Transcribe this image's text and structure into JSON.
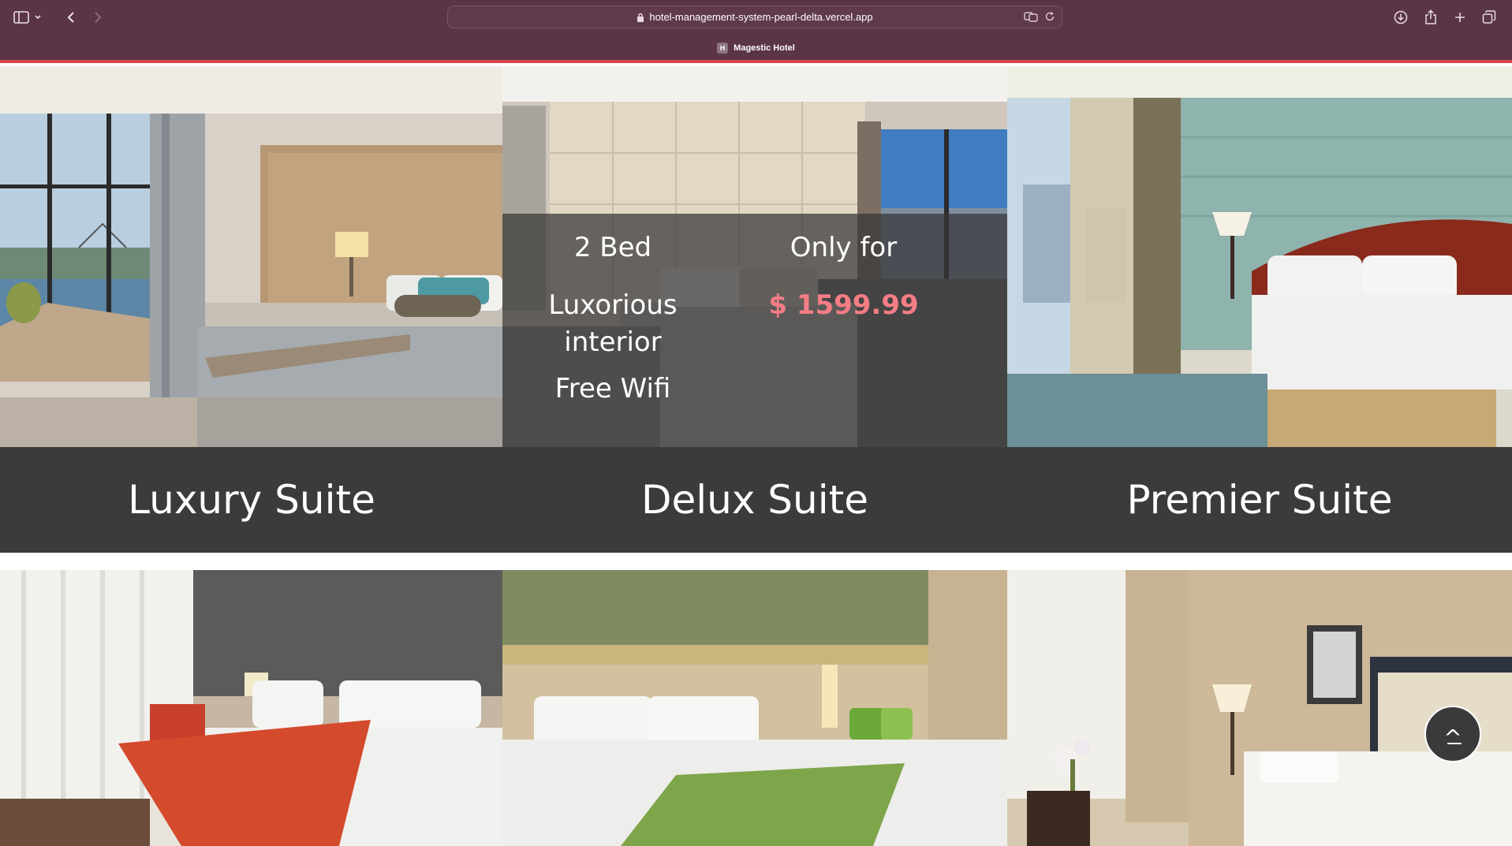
{
  "browser": {
    "url": "hotel-management-system-pearl-delta.vercel.app",
    "tab_title": "Magestic Hotel",
    "favicon_letter": "H"
  },
  "overlay": {
    "features": [
      "2 Bed",
      "Luxorious interior",
      "Free Wifi"
    ],
    "price_prefix": "Only for",
    "price": "$ 1599.99"
  },
  "suites": [
    {
      "name": "Luxury Suite"
    },
    {
      "name": "Delux Suite"
    },
    {
      "name": "Premier Suite"
    }
  ],
  "scroll_top_label": "^",
  "colors": {
    "chrome": "#5a3547",
    "accent": "#d64650",
    "label_bar": "#3b3b3b",
    "price": "#f47d86"
  }
}
